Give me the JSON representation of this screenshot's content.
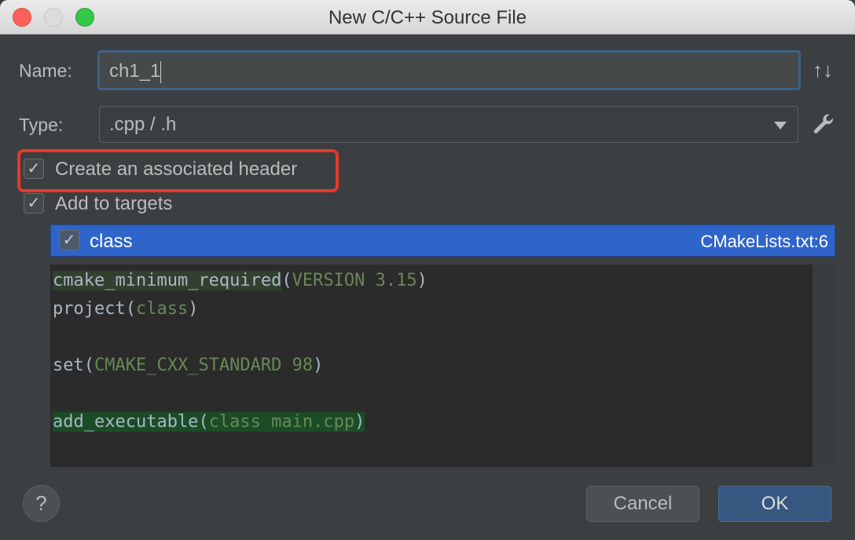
{
  "window": {
    "title": "New C/C++ Source File"
  },
  "form": {
    "name_label": "Name:",
    "name_value": "ch1_1",
    "type_label": "Type:",
    "type_value": ".cpp / .h",
    "create_header_label": "Create an associated header",
    "create_header_checked": true,
    "add_targets_label": "Add to targets",
    "add_targets_checked": true
  },
  "targets": [
    {
      "name": "class",
      "location": "CMakeLists.txt:6",
      "checked": true
    }
  ],
  "code": {
    "lines": [
      {
        "fn": "cmake_minimum_required",
        "arg": "VERSION 3.15"
      },
      {
        "fn": "project",
        "arg": "class"
      },
      {
        "fn": "set",
        "arg": "CMAKE_CXX_STANDARD 98"
      },
      {
        "fn": "add_executable",
        "arg": "class main.cpp"
      }
    ]
  },
  "buttons": {
    "help": "?",
    "cancel": "Cancel",
    "ok": "OK"
  },
  "icons": {
    "sort": "sort-arrows-icon",
    "settings": "wrench-icon"
  },
  "colors": {
    "accent": "#2f65ca",
    "highlight": "#e8372c",
    "ok": "#365880"
  }
}
